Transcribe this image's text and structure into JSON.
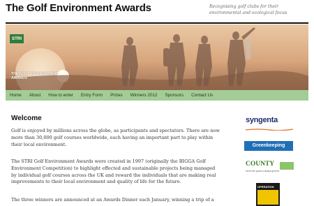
{
  "header": {
    "title": "The Golf Environment Awards",
    "tagline": "Recognising golf clubs for their environmental and ecological focus"
  },
  "banner": {
    "logo_text": "STRI",
    "award_text": "THE GOLF ENVIRONMENT AWARDS"
  },
  "nav": {
    "items": [
      "Home",
      "About",
      "How to enter",
      "Entry Form",
      "Prizes",
      "Winners 2012",
      "Sponsors",
      "Contact Us"
    ]
  },
  "main": {
    "heading": "Welcome",
    "paragraphs": [
      "Golf is enjoyed by millions across the globe, as participants and spectators. There are now more than 30,000 golf courses worldwide, each having an important part to play within their local environment.",
      "The STRI Golf Environment Awards were created in 1997 (originally the BIGGA Golf Environment Competition) to highlight effected and sustainable projects being managed by individual golf courses across the UK and reward the individuals that are making real improvements to their local environment and quality of life for the future.",
      "The three winners are announced at an Awards Dinner each January, winning a trip of a"
    ]
  },
  "sponsors": {
    "syngenta": "syngenta",
    "greenkeeping": "Greenkeeping",
    "county": "COUNTY",
    "county_sub": "where the grass is always greener",
    "operation": "OPERATION"
  }
}
